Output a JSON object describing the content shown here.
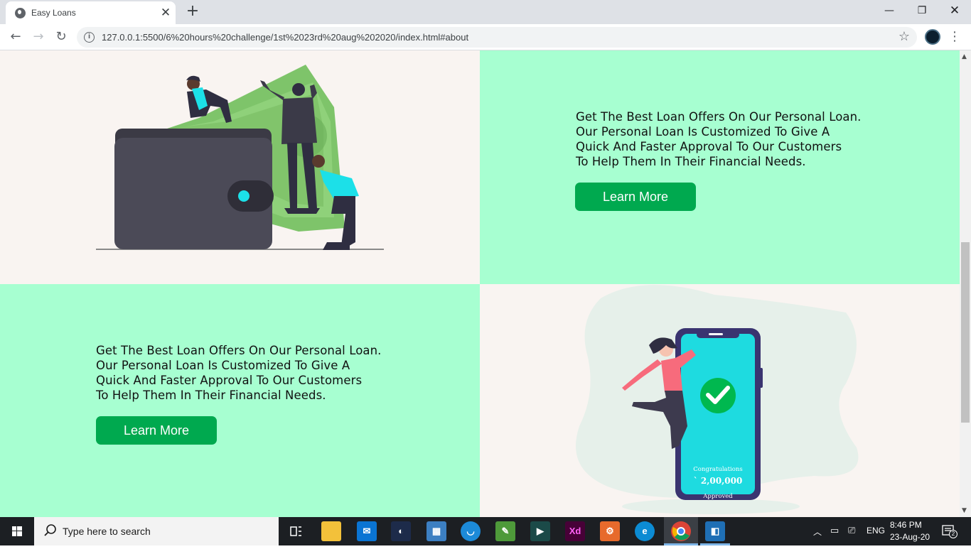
{
  "browser": {
    "tab_title": "Easy Loans",
    "tab_close": "✕",
    "new_tab": "+",
    "url": "127.0.0.1:5500/6%20hours%20challenge/1st%2023rd%20aug%202020/index.html#about",
    "window_minimize": "—",
    "window_restore": "❐",
    "window_close": "✕",
    "back": "←",
    "forward": "→",
    "reload": "↻",
    "bookmark_star": "☆",
    "menu": "⋮"
  },
  "page": {
    "section1": {
      "lines": [
        "Get The Best Loan Offers On Our Personal Loan.",
        "Our Personal Loan Is Customized To Give A",
        "Quick And Faster Approval To Our Customers",
        "To Help Them In Their Financial Needs."
      ],
      "button": "Learn More"
    },
    "section2": {
      "lines": [
        "Get The Best Loan Offers On Our Personal Loan.",
        "Our Personal Loan Is Customized To Give A",
        "Quick And Faster Approval To Our Customers",
        "To Help Them In Their Financial Needs."
      ],
      "button": "Learn More"
    },
    "phone": {
      "congrats": "Congratulations",
      "amount": "` 2,00,000",
      "approved": "Approved"
    },
    "colors": {
      "mint": "#a7ffd1",
      "cream": "#f9f4f1",
      "button": "#00a94f"
    }
  },
  "taskbar": {
    "search_placeholder": "Type here to search",
    "language": "ENG",
    "time": "8:46 PM",
    "date": "23-Aug-20",
    "notification_count": "2",
    "apps": [
      "task-view-icon",
      "file-explorer-icon",
      "mail-icon",
      "media-player-icon",
      "calculator-icon",
      "shield-app-icon",
      "notes-app-icon",
      "terminal-app-icon",
      "adobe-xd-icon",
      "dashboard-app-icon",
      "edge-icon",
      "chrome-icon",
      "vscode-icon"
    ],
    "xd_label": "Xd"
  }
}
